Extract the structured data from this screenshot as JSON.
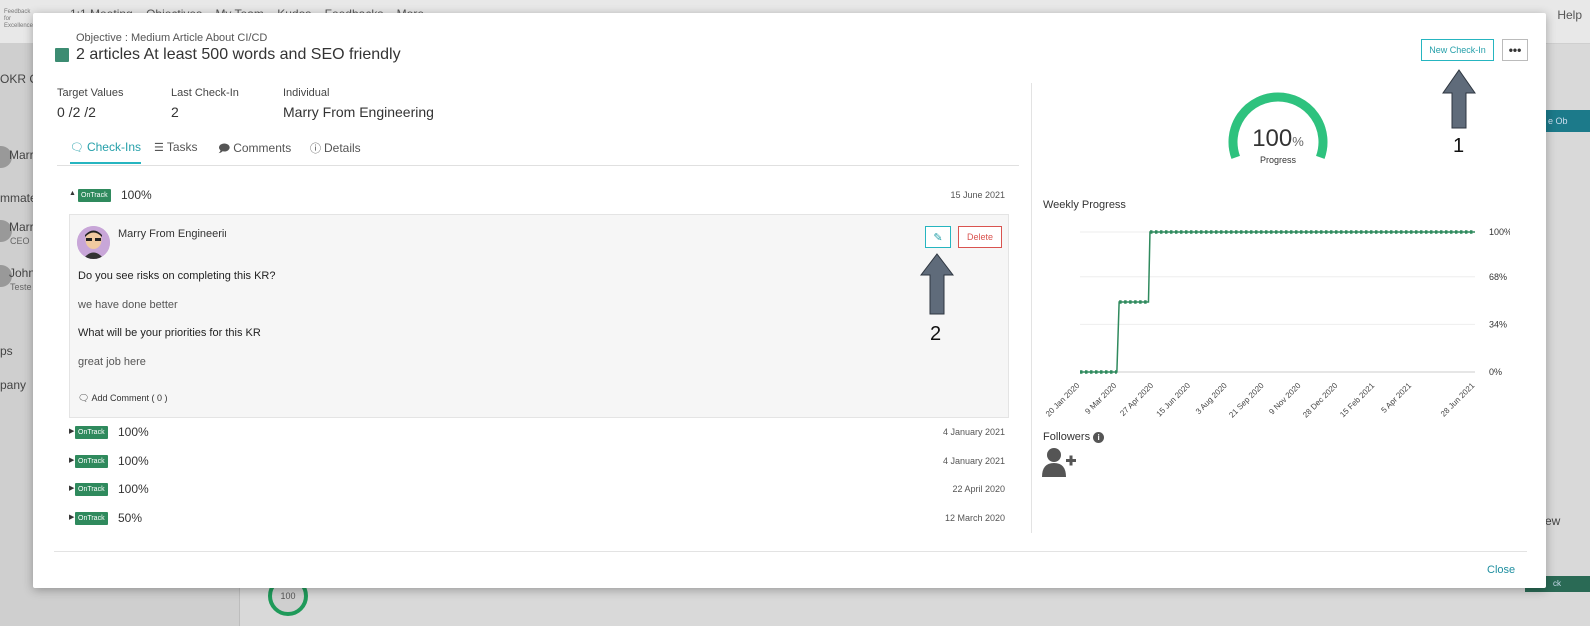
{
  "background": {
    "logo": "Feedback for Excellence",
    "nav": [
      "1:1 Meeting",
      "Objectives",
      "My Team",
      "Kudos",
      "Feedbacks",
      "More"
    ],
    "help": "Help",
    "sidebar_texts": [
      "OKR Cy",
      "Marr",
      "mmates",
      "Marr",
      "CEO",
      "John",
      "Teste",
      "ps",
      "pany"
    ],
    "ring_value": "100",
    "right_button": "e Ob",
    "right_button2": "ck",
    "right_dropdown": "ew"
  },
  "modal": {
    "objective_label": "Objective : Medium Article About CI/CD",
    "title": "2 articles At least 500 words and SEO friendly",
    "title_color": "#3c8c72",
    "new_checkin_label": "New Check-In",
    "more_label": "•••",
    "close_label": "Close",
    "meta": [
      {
        "label": "Target Values",
        "value": "0 /2 /2"
      },
      {
        "label": "Last Check-In",
        "value": "2"
      },
      {
        "label": "Individual",
        "value": "Marry From Engineering"
      }
    ],
    "tabs": [
      {
        "label": "Check-Ins",
        "icon": "comment-icon"
      },
      {
        "label": "Tasks",
        "icon": "list-icon"
      },
      {
        "label": "Comments",
        "icon": "comments-icon"
      },
      {
        "label": "Details",
        "icon": "info-icon"
      }
    ],
    "checkins": [
      {
        "status": "OnTrack",
        "progress": "100%",
        "date": "15 June 2021",
        "expanded": true
      },
      {
        "status": "OnTrack",
        "progress": "100%",
        "date": "4 January 2021",
        "expanded": false
      },
      {
        "status": "OnTrack",
        "progress": "100%",
        "date": "4 January 2021",
        "expanded": false
      },
      {
        "status": "OnTrack",
        "progress": "100%",
        "date": "22 April 2020",
        "expanded": false
      },
      {
        "status": "OnTrack",
        "progress": "50%",
        "date": "12 March 2020",
        "expanded": false
      }
    ],
    "expanded_checkin": {
      "author": "Marry From Engineering",
      "delete_label": "Delete",
      "q1": "Do you see risks on completing this KR?",
      "a1": "we have done better",
      "q2": "What will be your priorities for this KR",
      "a2": "great job here",
      "add_comment": "Add Comment ( 0 )"
    },
    "progress": {
      "value": "100",
      "unit": "%",
      "label": "Progress",
      "fraction": 1.0,
      "color": "#2ec27e"
    },
    "weekly_title": "Weekly Progress",
    "followers_title": "Followers"
  },
  "annotations": {
    "arrow1": "1",
    "arrow2": "2"
  },
  "chart_data": {
    "type": "line",
    "title": "Weekly Progress",
    "x": [
      "20 Jan 2020",
      "9 Mar 2020",
      "27 Apr 2020",
      "15 Jun 2020",
      "3 Aug 2020",
      "21 Sep 2020",
      "9 Nov 2020",
      "28 Dec 2020",
      "15 Feb 2021",
      "5 Apr 2021",
      "28 Jun 2021"
    ],
    "y_ticks": [
      "0%",
      "34%",
      "68%",
      "100%"
    ],
    "ylim": [
      0,
      100
    ],
    "series": [
      {
        "values": [
          {
            "x": "2020-01-20",
            "y": 0
          },
          {
            "x": "2020-03-09",
            "y": 0
          },
          {
            "x": "2020-03-12",
            "y": 50
          },
          {
            "x": "2020-04-20",
            "y": 50
          },
          {
            "x": "2020-04-22",
            "y": 100
          },
          {
            "x": "2021-06-28",
            "y": 100
          }
        ],
        "color": "#2f8a5d"
      }
    ],
    "grid": true
  }
}
